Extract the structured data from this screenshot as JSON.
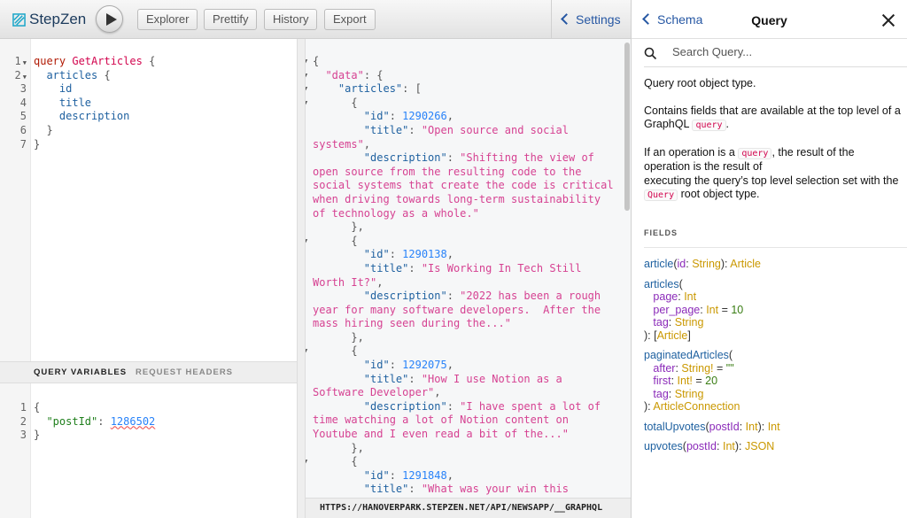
{
  "toolbar": {
    "logo": "StepZen",
    "run_icon": "play-icon",
    "buttons": [
      "Explorer",
      "Prettify",
      "History",
      "Export"
    ],
    "settings": "Settings"
  },
  "query_editor": {
    "lines": [
      [
        [
          "kw",
          "query "
        ],
        [
          "def",
          "GetArticles"
        ],
        [
          "pn",
          " {"
        ]
      ],
      [
        [
          "pn",
          "  "
        ],
        [
          "fld",
          "articles"
        ],
        [
          "pn",
          " {"
        ]
      ],
      [
        [
          "fld",
          "    id"
        ]
      ],
      [
        [
          "fld",
          "    title"
        ]
      ],
      [
        [
          "fld",
          "    description"
        ]
      ],
      [
        [
          "pn",
          "  }"
        ]
      ],
      [
        [
          "pn",
          "}"
        ]
      ]
    ],
    "folds": [
      1,
      2
    ]
  },
  "variables": {
    "tabs": [
      "QUERY VARIABLES",
      "REQUEST HEADERS"
    ],
    "active_tab": "QUERY VARIABLES",
    "lines": [
      [
        [
          "pn",
          "{"
        ]
      ],
      [
        [
          "pn",
          "  "
        ],
        [
          "vk",
          "\"postId\""
        ],
        [
          "pn",
          ": "
        ],
        [
          "vn",
          "1286502"
        ]
      ],
      [
        [
          "pn",
          "}"
        ]
      ]
    ]
  },
  "result": {
    "lines": [
      [
        [
          "rp",
          "{"
        ]
      ],
      [
        [
          "rp",
          "  "
        ],
        [
          "rs",
          "\"data\""
        ],
        [
          "rp",
          ": {"
        ]
      ],
      [
        [
          "rp",
          "    "
        ],
        [
          "rk",
          "\"articles\""
        ],
        [
          "rp",
          ": ["
        ]
      ],
      [
        [
          "rp",
          "      {"
        ]
      ],
      [
        [
          "rp",
          "        "
        ],
        [
          "rk",
          "\"id\""
        ],
        [
          "rp",
          ": "
        ],
        [
          "rn",
          "1290266"
        ],
        [
          "rp",
          ","
        ]
      ],
      [
        [
          "rp",
          "        "
        ],
        [
          "rk",
          "\"title\""
        ],
        [
          "rp",
          ": "
        ],
        [
          "rs",
          "\"Open source and social"
        ]
      ],
      [
        [
          "rs",
          "systems\""
        ],
        [
          "rp",
          ","
        ]
      ],
      [
        [
          "rp",
          "        "
        ],
        [
          "rk",
          "\"description\""
        ],
        [
          "rp",
          ": "
        ],
        [
          "rs",
          "\"Shifting the view of"
        ]
      ],
      [
        [
          "rs",
          "open source from the resulting code to the"
        ]
      ],
      [
        [
          "rs",
          "social systems that create the code is critical"
        ]
      ],
      [
        [
          "rs",
          "when driving towards long-term sustainability"
        ]
      ],
      [
        [
          "rs",
          "of technology as a whole.\""
        ]
      ],
      [
        [
          "rp",
          "      },"
        ]
      ],
      [
        [
          "rp",
          "      {"
        ]
      ],
      [
        [
          "rp",
          "        "
        ],
        [
          "rk",
          "\"id\""
        ],
        [
          "rp",
          ": "
        ],
        [
          "rn",
          "1290138"
        ],
        [
          "rp",
          ","
        ]
      ],
      [
        [
          "rp",
          "        "
        ],
        [
          "rk",
          "\"title\""
        ],
        [
          "rp",
          ": "
        ],
        [
          "rs",
          "\"Is Working In Tech Still"
        ]
      ],
      [
        [
          "rs",
          "Worth It?\""
        ],
        [
          "rp",
          ","
        ]
      ],
      [
        [
          "rp",
          "        "
        ],
        [
          "rk",
          "\"description\""
        ],
        [
          "rp",
          ": "
        ],
        [
          "rs",
          "\"2022 has been a rough"
        ]
      ],
      [
        [
          "rs",
          "year for many software developers.  After the"
        ]
      ],
      [
        [
          "rs",
          "mass hiring seen during the...\""
        ]
      ],
      [
        [
          "rp",
          "      },"
        ]
      ],
      [
        [
          "rp",
          "      {"
        ]
      ],
      [
        [
          "rp",
          "        "
        ],
        [
          "rk",
          "\"id\""
        ],
        [
          "rp",
          ": "
        ],
        [
          "rn",
          "1292075"
        ],
        [
          "rp",
          ","
        ]
      ],
      [
        [
          "rp",
          "        "
        ],
        [
          "rk",
          "\"title\""
        ],
        [
          "rp",
          ": "
        ],
        [
          "rs",
          "\"How I use Notion as a"
        ]
      ],
      [
        [
          "rs",
          "Software Developer\""
        ],
        [
          "rp",
          ","
        ]
      ],
      [
        [
          "rp",
          "        "
        ],
        [
          "rk",
          "\"description\""
        ],
        [
          "rp",
          ": "
        ],
        [
          "rs",
          "\"I have spent a lot of"
        ]
      ],
      [
        [
          "rs",
          "time watching a lot of Notion content on"
        ]
      ],
      [
        [
          "rs",
          "Youtube and I even read a bit of the...\""
        ]
      ],
      [
        [
          "rp",
          "      },"
        ]
      ],
      [
        [
          "rp",
          "      {"
        ]
      ],
      [
        [
          "rp",
          "        "
        ],
        [
          "rk",
          "\"id\""
        ],
        [
          "rp",
          ": "
        ],
        [
          "rn",
          "1291848"
        ],
        [
          "rp",
          ","
        ]
      ],
      [
        [
          "rp",
          "        "
        ],
        [
          "rk",
          "\"title\""
        ],
        [
          "rp",
          ": "
        ],
        [
          "rs",
          "\"What was your win this"
        ]
      ]
    ],
    "folds": [
      1,
      2,
      3,
      4,
      14,
      22,
      30
    ],
    "endpoint": "HTTPS://HANOVERPARK.STEPZEN.NET/API/NEWSAPP/__GRAPHQL"
  },
  "docs": {
    "back": "Schema",
    "title": "Query",
    "search_placeholder": "Search Query...",
    "description": {
      "p1": "Query root object type.",
      "p2a": "Contains fields that are available at the top level of a GraphQL ",
      "p2code": "query",
      "p2b": ".",
      "p3a": "If an operation is a ",
      "p3code": "query",
      "p3b": ", the result of the operation is the result of",
      "p3c": "executing the query’s top level selection set with the ",
      "p3code2": "Query",
      "p3d": " root object type."
    },
    "fields_header": "FIELDS",
    "fields": [
      [
        [
          [
            "ff",
            "article"
          ],
          [
            "fp",
            "("
          ],
          [
            "fa",
            "id"
          ],
          [
            "fp",
            ": "
          ],
          [
            "ft",
            "String"
          ],
          [
            "fp",
            "): "
          ],
          [
            "ft",
            "Article"
          ]
        ]
      ],
      [
        [
          [
            "ff",
            "articles"
          ],
          [
            "fp",
            "("
          ]
        ],
        [
          [
            "fa",
            "   page"
          ],
          [
            "fp",
            ": "
          ],
          [
            "ft",
            "Int"
          ]
        ],
        [
          [
            "fa",
            "   per_page"
          ],
          [
            "fp",
            ": "
          ],
          [
            "ft",
            "Int"
          ],
          [
            "fp",
            " = "
          ],
          [
            "fd",
            "10"
          ]
        ],
        [
          [
            "fa",
            "   tag"
          ],
          [
            "fp",
            ": "
          ],
          [
            "ft",
            "String"
          ]
        ],
        [
          [
            "fp",
            "): ["
          ],
          [
            "ft",
            "Article"
          ],
          [
            "fp",
            "]"
          ]
        ]
      ],
      [
        [
          [
            "ff",
            "paginatedArticles"
          ],
          [
            "fp",
            "("
          ]
        ],
        [
          [
            "fa",
            "   after"
          ],
          [
            "fp",
            ": "
          ],
          [
            "ft",
            "String!"
          ],
          [
            "fp",
            " = "
          ],
          [
            "fd",
            "\"\""
          ]
        ],
        [
          [
            "fa",
            "   first"
          ],
          [
            "fp",
            ": "
          ],
          [
            "ft",
            "Int!"
          ],
          [
            "fp",
            " = "
          ],
          [
            "fd",
            "20"
          ]
        ],
        [
          [
            "fa",
            "   tag"
          ],
          [
            "fp",
            ": "
          ],
          [
            "ft",
            "String"
          ]
        ],
        [
          [
            "fp",
            "): "
          ],
          [
            "ft",
            "ArticleConnection"
          ]
        ]
      ],
      [
        [
          [
            "ff",
            "totalUpvotes"
          ],
          [
            "fp",
            "("
          ],
          [
            "fa",
            "postId"
          ],
          [
            "fp",
            ": "
          ],
          [
            "ft",
            "Int"
          ],
          [
            "fp",
            "): "
          ],
          [
            "ft",
            "Int"
          ]
        ]
      ],
      [
        [
          [
            "ff",
            "upvotes"
          ],
          [
            "fp",
            "("
          ],
          [
            "fa",
            "postId"
          ],
          [
            "fp",
            ": "
          ],
          [
            "ft",
            "Int"
          ],
          [
            "fp",
            "): "
          ],
          [
            "ft",
            "JSON"
          ]
        ]
      ]
    ]
  }
}
